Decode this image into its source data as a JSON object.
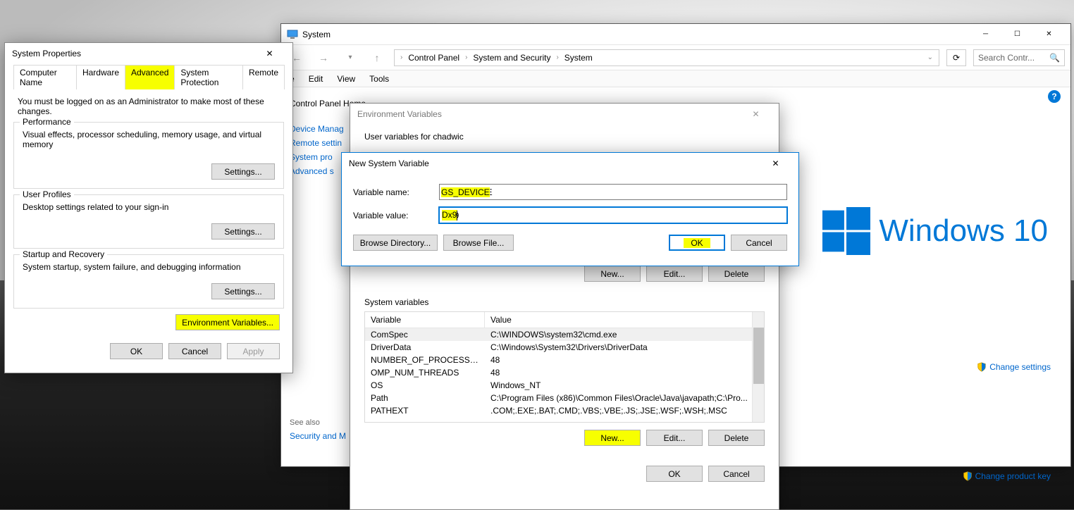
{
  "desktop": {
    "os_label": "Windows 10"
  },
  "system_window": {
    "title": "System",
    "nav": {
      "back": "←",
      "fwd": "→",
      "up": "↑"
    },
    "breadcrumbs": [
      "Control Panel",
      "System and Security",
      "System"
    ],
    "search_placeholder": "Search Contr...",
    "menubar": [
      "e",
      "Edit",
      "View",
      "Tools"
    ],
    "sidebar": {
      "home": "Control Panel Home",
      "links": [
        "Device Manag",
        "Remote settin",
        "System pro",
        "Advanced s"
      ],
      "see_also": "See also",
      "see_also_items": [
        "Security and M"
      ]
    },
    "right_links": {
      "change_settings": "Change settings",
      "change_product_key": "Change product key"
    }
  },
  "sysprops": {
    "title": "System Properties",
    "tabs": [
      "Computer Name",
      "Hardware",
      "Advanced",
      "System Protection",
      "Remote"
    ],
    "active_tab": 2,
    "admin_note": "You must be logged on as an Administrator to make most of these changes.",
    "perf": {
      "label": "Performance",
      "desc": "Visual effects, processor scheduling, memory usage, and virtual memory",
      "btn": "Settings..."
    },
    "profiles": {
      "label": "User Profiles",
      "desc": "Desktop settings related to your sign-in",
      "btn": "Settings..."
    },
    "startup": {
      "label": "Startup and Recovery",
      "desc": "System startup, system failure, and debugging information",
      "btn": "Settings..."
    },
    "envvar_btn": "Environment Variables...",
    "ok": "OK",
    "cancel": "Cancel",
    "apply": "Apply"
  },
  "envvars": {
    "title": "Environment Variables",
    "user_label": "User variables for chadwic",
    "sys_label": "System variables",
    "col_var": "Variable",
    "col_val": "Value",
    "sys_rows": [
      {
        "var": "ComSpec",
        "val": "C:\\WINDOWS\\system32\\cmd.exe"
      },
      {
        "var": "DriverData",
        "val": "C:\\Windows\\System32\\Drivers\\DriverData"
      },
      {
        "var": "NUMBER_OF_PROCESSORS",
        "val": "48"
      },
      {
        "var": "OMP_NUM_THREADS",
        "val": "48"
      },
      {
        "var": "OS",
        "val": "Windows_NT"
      },
      {
        "var": "Path",
        "val": "C:\\Program Files (x86)\\Common Files\\Oracle\\Java\\javapath;C:\\Pro..."
      },
      {
        "var": "PATHEXT",
        "val": ".COM;.EXE;.BAT;.CMD;.VBS;.VBE;.JS;.JSE;.WSF;.WSH;.MSC"
      }
    ],
    "new": "New...",
    "edit": "Edit...",
    "delete": "Delete",
    "ok": "OK",
    "cancel": "Cancel"
  },
  "newvar": {
    "title": "New System Variable",
    "name_label": "Variable name:",
    "name_value": "GS_DEVICE",
    "value_label": "Variable value:",
    "value_value": "Dx9",
    "browse_dir": "Browse Directory...",
    "browse_file": "Browse File...",
    "ok": "OK",
    "cancel": "Cancel"
  }
}
